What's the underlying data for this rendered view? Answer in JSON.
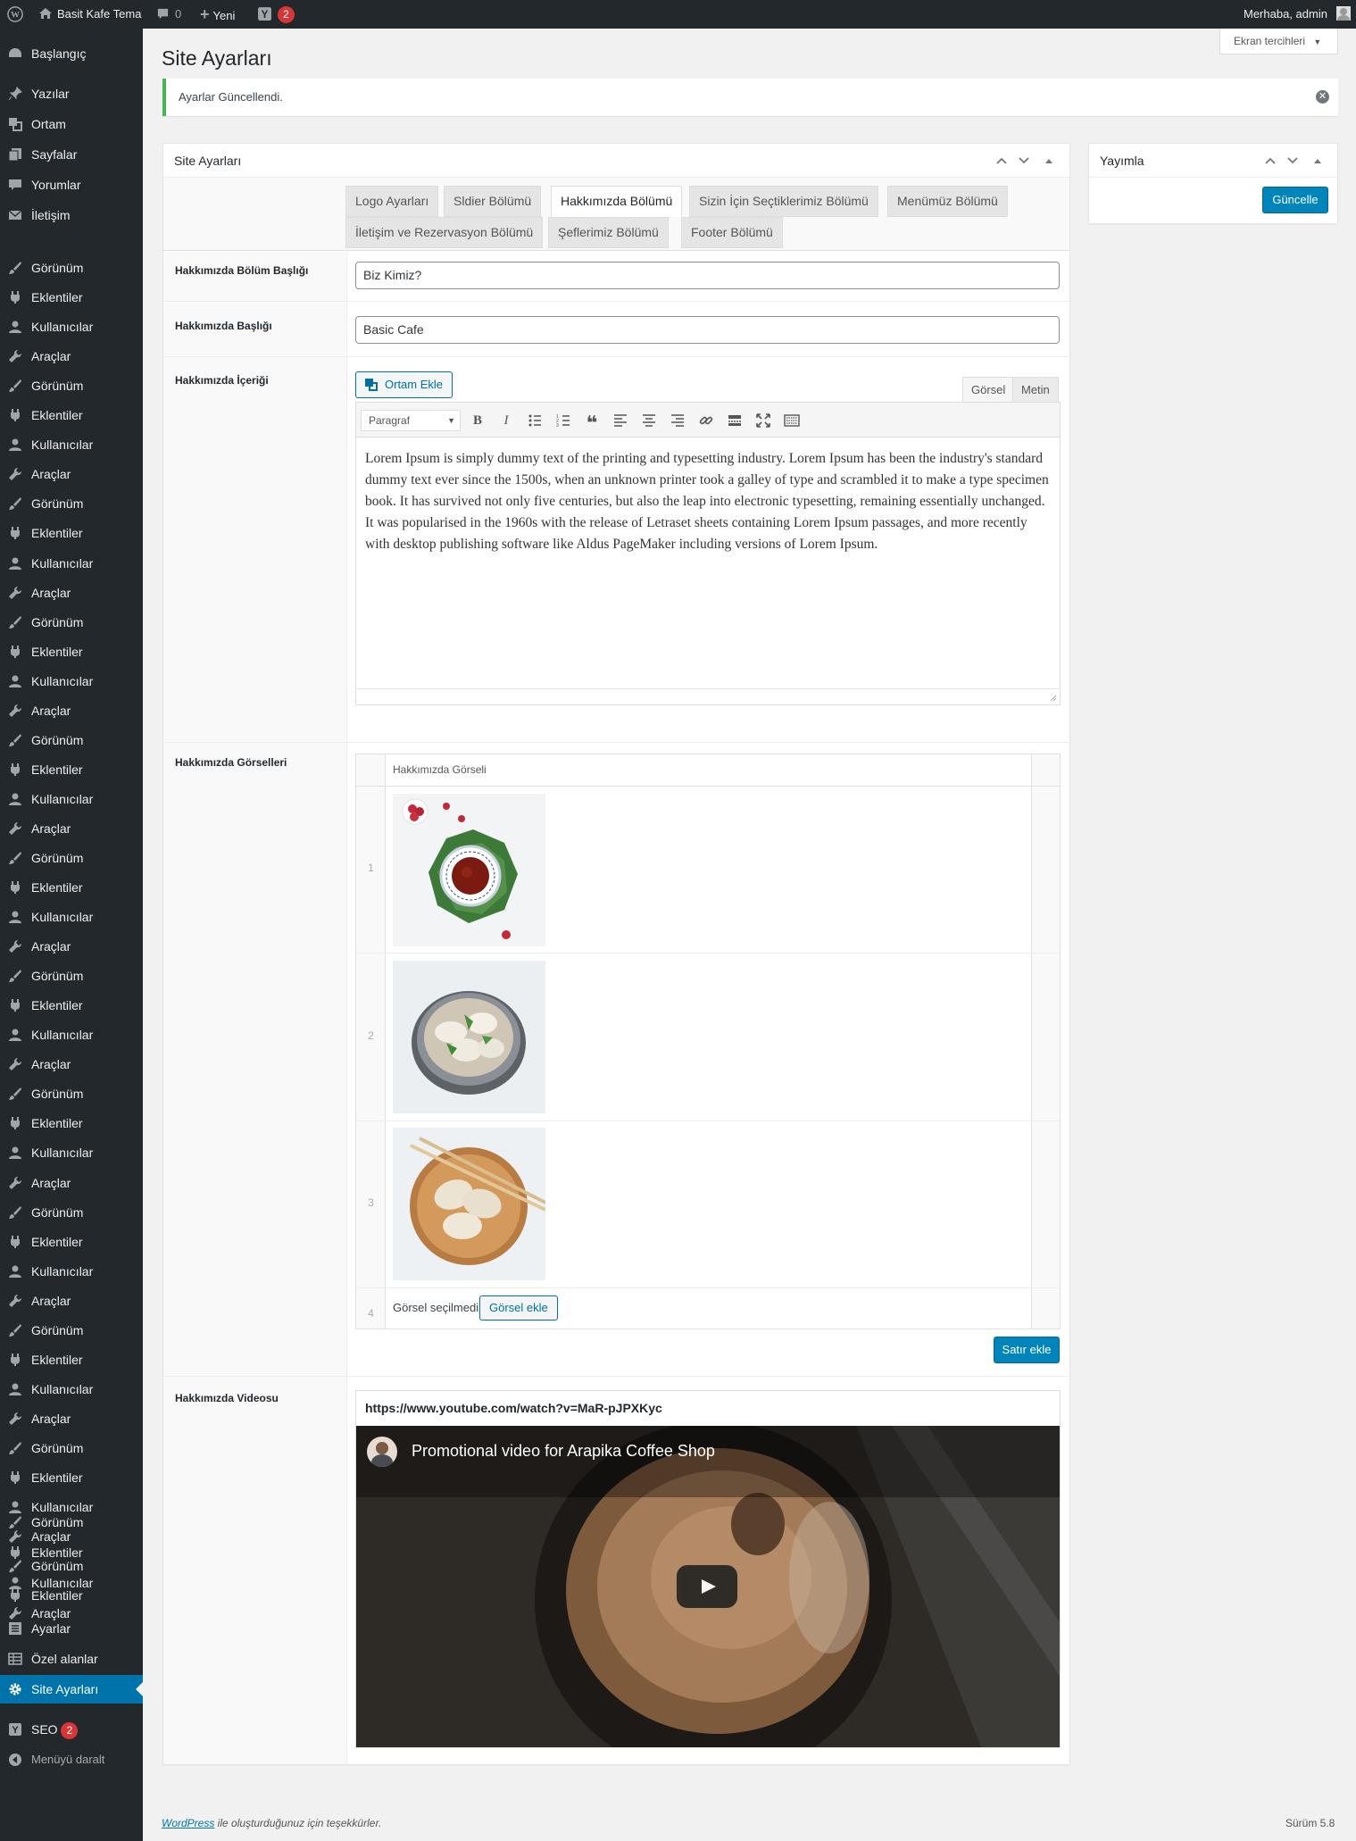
{
  "admin_bar": {
    "site_name": "Basit Kafe Tema",
    "comments_count": "0",
    "new_label": "Yeni",
    "seo_badge": "2",
    "greeting": "Merhaba, admin"
  },
  "sidebar": {
    "dashboard": "Başlangıç",
    "posts": "Yazılar",
    "media": "Ortam",
    "pages": "Sayfalar",
    "comments": "Yorumlar",
    "contact": "İletişim",
    "repeated_group": [
      "Görünüm",
      "Eklentiler",
      "Kullanıcılar",
      "Araçlar"
    ],
    "settings": "Ayarlar",
    "custom_fields": "Özel alanlar",
    "site_settings": "Site Ayarları",
    "seo": "SEO",
    "seo_badge": "2",
    "collapse": "Menüyü daralt"
  },
  "page": {
    "title": "Site Ayarları",
    "screen_options": "Ekran tercihleri",
    "notice": "Ayarlar Güncellendi."
  },
  "settings_box": {
    "title": "Site Ayarları",
    "tabs": [
      "Logo Ayarları",
      "Sldier Bölümü",
      "Hakkımızda Bölümü",
      "Sizin İçin Seçtiklerimiz Bölümü",
      "Menümüz Bölümü",
      "İletişim ve Rezervasyon Bölümü",
      "Şeflerimiz Bölümü",
      "Footer Bölümü"
    ],
    "active_tab": "Hakkımızda Bölümü",
    "fields": {
      "section_title_label": "Hakkımızda Bölüm Başlığı",
      "section_title_value": "Biz Kimiz?",
      "heading_label": "Hakkımızda Başlığı",
      "heading_value": "Basic Cafe",
      "content_label": "Hakkımızda İçeriği",
      "add_media": "Ortam Ekle",
      "tab_visual": "Görsel",
      "tab_text": "Metin",
      "format": "Paragraf",
      "content": "Lorem Ipsum is simply dummy text of the printing and typesetting industry. Lorem Ipsum has been the industry's standard dummy text ever since the 1500s, when an unknown printer took a galley of type and scrambled it to make a type specimen book. It has survived not only five centuries, but also the leap into electronic typesetting, remaining essentially unchanged. It was popularised in the 1960s with the release of Letraset sheets containing Lorem Ipsum passages, and more recently with desktop publishing software like Aldus PageMaker including versions of Lorem Ipsum.",
      "images_label": "Hakkımızda Görselleri",
      "images_column": "Hakkımızda Görseli",
      "image_rows": [
        "1",
        "2",
        "3",
        "4"
      ],
      "no_image": "Görsel seçilmedi",
      "add_image": "Görsel ekle",
      "add_row": "Satır ekle",
      "video_label": "Hakkımızda Videosu",
      "video_url": "https://www.youtube.com/watch?v=MaR-pJPXKyc",
      "video_title": "Promotional video for Arapika Coffee Shop"
    }
  },
  "publish_box": {
    "title": "Yayımla",
    "update": "Güncelle"
  },
  "footer": {
    "link": "WordPress",
    "thanks": " ile oluşturduğunuz için teşekkürler.",
    "version": "Sürüm 5.8"
  },
  "colors": {
    "admin_dark": "#23282d",
    "accent_blue": "#0073aa",
    "notice_green": "#46b450",
    "badge_red": "#d63638"
  }
}
